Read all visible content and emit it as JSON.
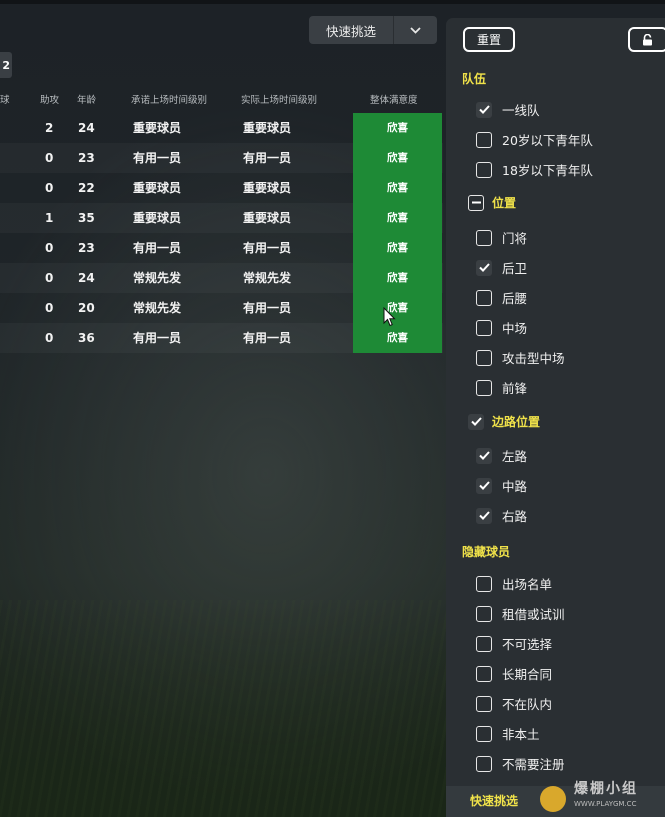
{
  "quick_pick": {
    "label": "快速挑选"
  },
  "page_tag": "2",
  "table": {
    "headers": {
      "goals_partial": "球",
      "assists": "助攻",
      "age": "年龄",
      "promised": "承诺上场时间级别",
      "actual": "实际上场时间级别",
      "satisfaction": "整体满意度"
    },
    "rows": [
      {
        "assists": "2",
        "age": "24",
        "promised": "重要球员",
        "actual": "重要球员",
        "satisfaction": "欣喜"
      },
      {
        "assists": "0",
        "age": "23",
        "promised": "有用一员",
        "actual": "有用一员",
        "satisfaction": "欣喜"
      },
      {
        "assists": "0",
        "age": "22",
        "promised": "重要球员",
        "actual": "重要球员",
        "satisfaction": "欣喜"
      },
      {
        "assists": "1",
        "age": "35",
        "promised": "重要球员",
        "actual": "重要球员",
        "satisfaction": "欣喜"
      },
      {
        "assists": "0",
        "age": "23",
        "promised": "有用一员",
        "actual": "有用一员",
        "satisfaction": "欣喜"
      },
      {
        "assists": "0",
        "age": "24",
        "promised": "常规先发",
        "actual": "常规先发",
        "satisfaction": "欣喜"
      },
      {
        "assists": "0",
        "age": "20",
        "promised": "常规先发",
        "actual": "有用一员",
        "satisfaction": "欣喜"
      },
      {
        "assists": "0",
        "age": "36",
        "promised": "有用一员",
        "actual": "有用一员",
        "satisfaction": "欣喜"
      }
    ],
    "satisfaction_color": "#1e8a36"
  },
  "panel": {
    "reset_label": "重置",
    "lock_icon": "lock-icon",
    "sections": {
      "squad": {
        "title": "队伍",
        "items": [
          {
            "label": "一线队",
            "checked": true
          },
          {
            "label": "20岁以下青年队",
            "checked": false
          },
          {
            "label": "18岁以下青年队",
            "checked": false
          }
        ]
      },
      "position": {
        "title": "位置",
        "state": "partial",
        "items": [
          {
            "label": "门将",
            "checked": false
          },
          {
            "label": "后卫",
            "checked": true
          },
          {
            "label": "后腰",
            "checked": false
          },
          {
            "label": "中场",
            "checked": false
          },
          {
            "label": "攻击型中场",
            "checked": false
          },
          {
            "label": "前锋",
            "checked": false
          }
        ]
      },
      "side": {
        "title": "边路位置",
        "state": "checked",
        "items": [
          {
            "label": "左路",
            "checked": true
          },
          {
            "label": "中路",
            "checked": true
          },
          {
            "label": "右路",
            "checked": true
          }
        ]
      },
      "hidden": {
        "title": "隐藏球员",
        "items": [
          {
            "label": "出场名单",
            "checked": false
          },
          {
            "label": "租借或试训",
            "checked": false
          },
          {
            "label": "不可选择",
            "checked": false
          },
          {
            "label": "长期合同",
            "checked": false
          },
          {
            "label": "不在队内",
            "checked": false
          },
          {
            "label": "非本土",
            "checked": false
          },
          {
            "label": "不需要注册",
            "checked": false
          }
        ]
      }
    },
    "footer_label": "快速挑选"
  },
  "watermark": {
    "cn": "爆棚小组",
    "url": "WWW.PLAYGM.CC"
  },
  "colors": {
    "accent_yellow": "#f0e24a",
    "panel_bg": "#2a2f33"
  }
}
